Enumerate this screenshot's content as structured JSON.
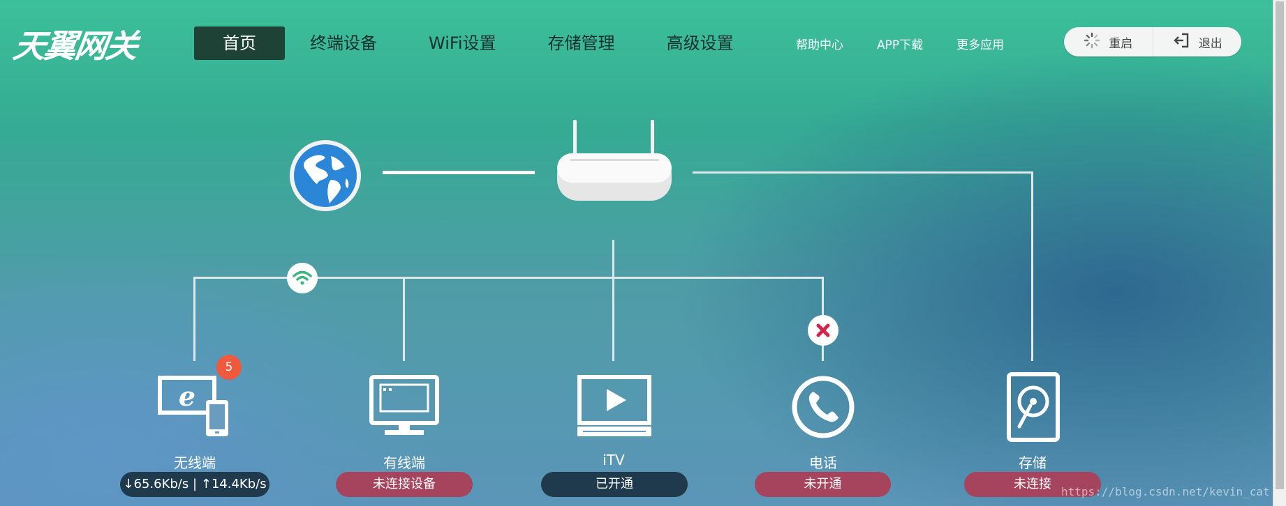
{
  "logo": {
    "text": "天翼网关"
  },
  "nav": {
    "items": [
      {
        "label": "首页",
        "active": true
      },
      {
        "label": "终端设备"
      },
      {
        "label": "WiFi设置"
      },
      {
        "label": "存储管理"
      },
      {
        "label": "高级设置"
      }
    ]
  },
  "toplinks": {
    "help": "帮助中心",
    "app": "APP下载",
    "more": "更多应用"
  },
  "actions": {
    "restart": "重启",
    "logout": "退出"
  },
  "topology": {
    "wireless": {
      "label": "无线端",
      "badge": "5",
      "status": "↓65.6Kb/s | ↑14.4Kb/s"
    },
    "wired": {
      "label": "有线端",
      "status": "未连接设备"
    },
    "itv": {
      "label": "iTV",
      "status": "已开通"
    },
    "phone": {
      "label": "电话",
      "status": "未开通"
    },
    "storage": {
      "label": "存储",
      "status": "未连接"
    }
  },
  "colors": {
    "active_nav": "#1e4336",
    "status_dark": "#1f3a4c",
    "status_red": "#a6445e",
    "badge": "#ef5a3e",
    "error_x": "#d6234a",
    "wifi_green": "#3fb57f"
  },
  "watermark": "https://blog.csdn.net/kevin_cat"
}
